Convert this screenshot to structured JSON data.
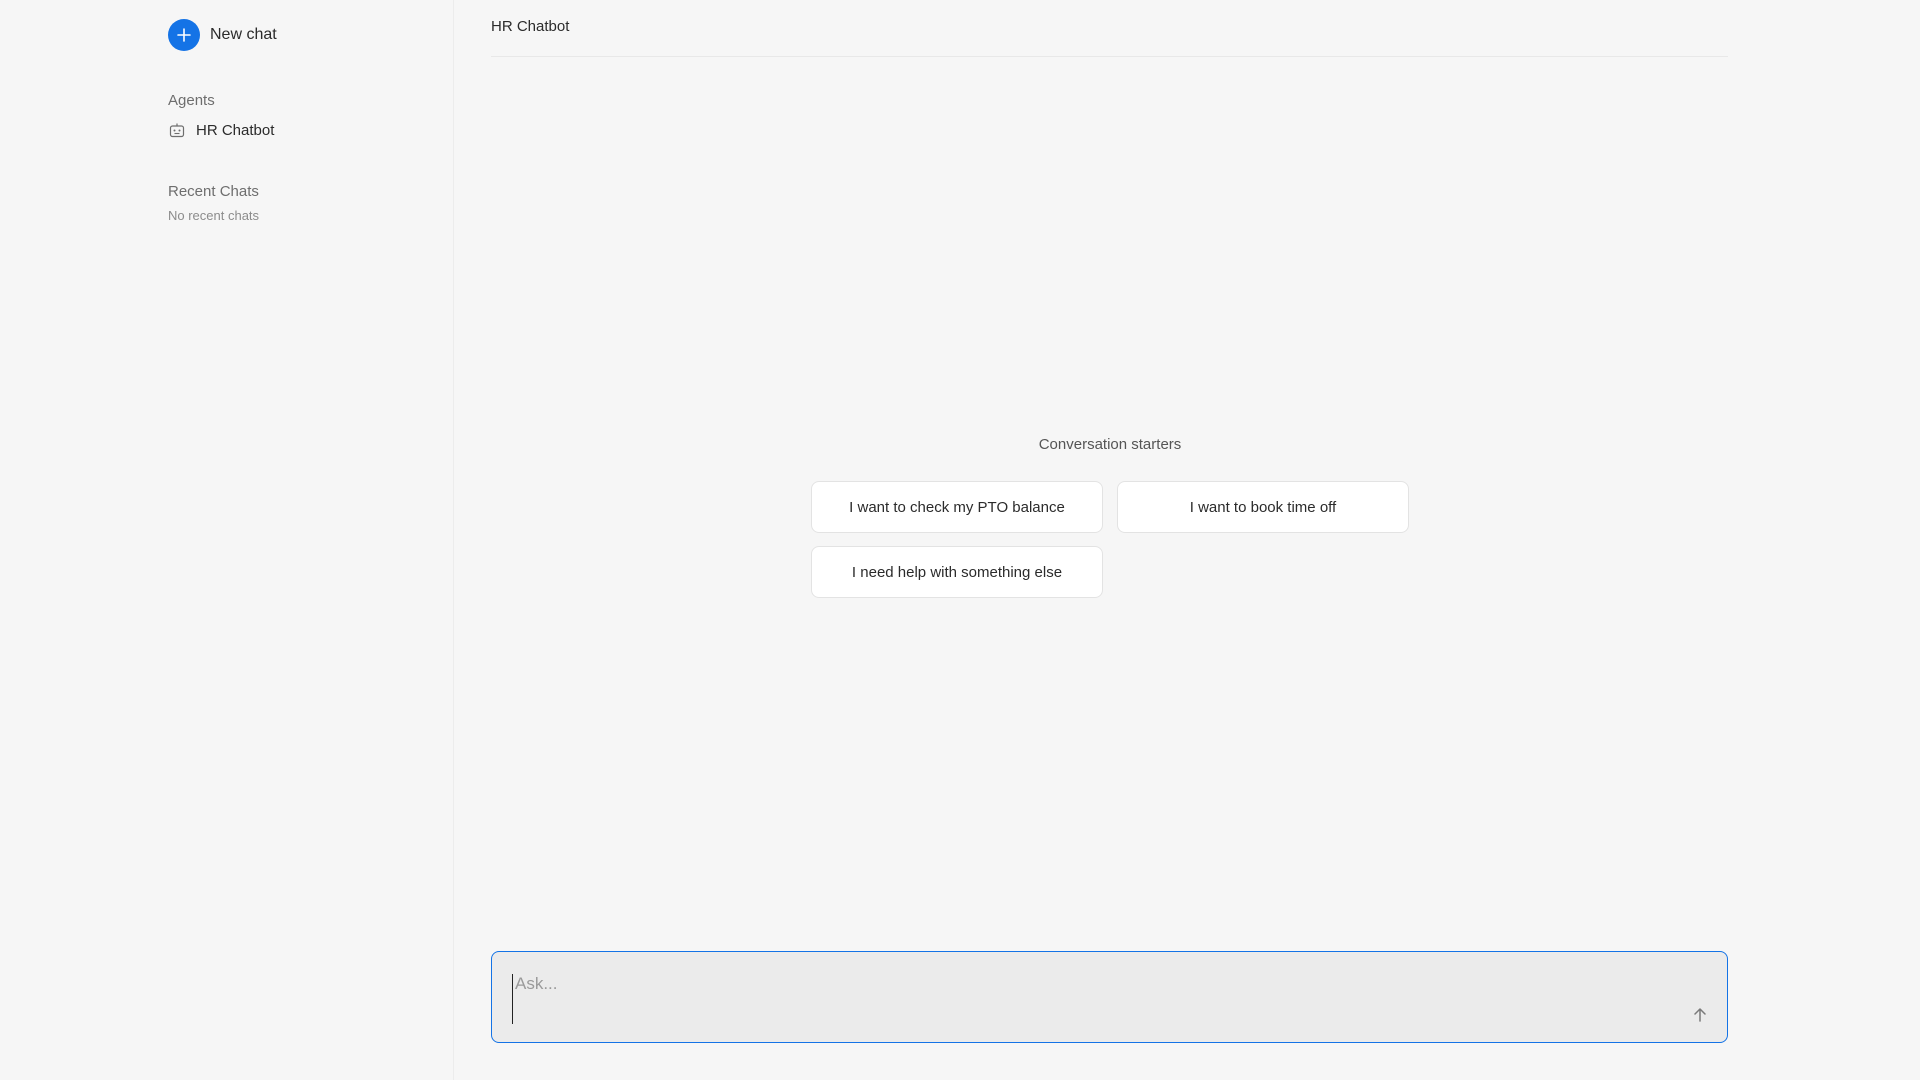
{
  "sidebar": {
    "new_chat_label": "New chat",
    "new_chat_icon": "plus-icon",
    "agents_title": "Agents",
    "agents": [
      {
        "label": "HR Chatbot",
        "icon": "bot-icon"
      }
    ],
    "recent_title": "Recent Chats",
    "recent_empty": "No recent chats"
  },
  "header": {
    "title": "HR Chatbot"
  },
  "starters": {
    "title": "Conversation starters",
    "items": [
      "I want to check my PTO balance",
      "I want to book time off",
      "I need help with something else"
    ]
  },
  "composer": {
    "placeholder": "Ask...",
    "value": "",
    "send_icon": "arrow-up-icon"
  },
  "colors": {
    "accent": "#1473e6",
    "background": "#f6f6f6",
    "composer_bg": "#ebebeb"
  }
}
